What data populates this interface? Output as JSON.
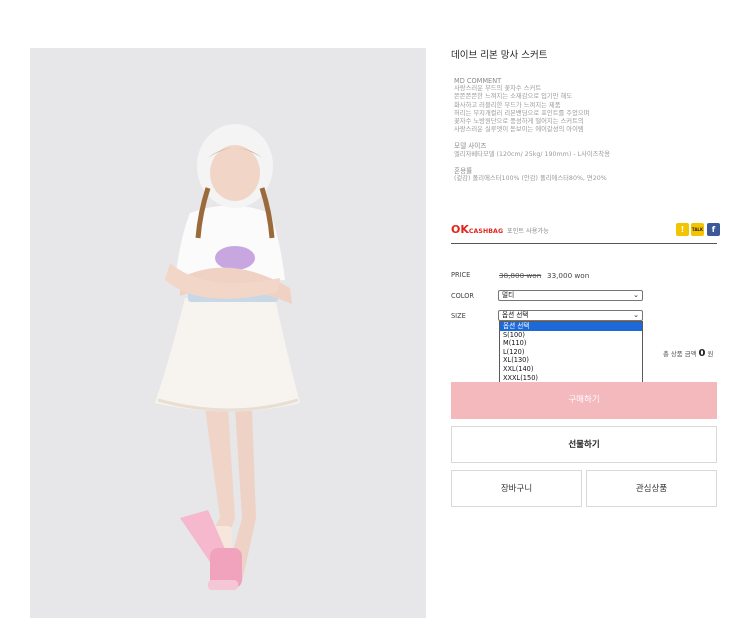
{
  "product": {
    "image_alt": "child model wearing white tulle skirt",
    "title": "데이브 리본 망사 스커트",
    "description": {
      "md_heading": "MD COMMENT",
      "md_lines": [
        "사랑스러운 무드의 꽃자수 스커트",
        "쫀쫀쫀쫀한 느껴지는 소재감으로 입기만 해도",
        "화사하고 러블리한 무드가 느껴지는 제품",
        "허리는 무지개컬러 리본밴딩으로 포인트를 주었으며",
        "꽃자수 노방원단으로 풍성하게 떨어지는 스커트의",
        "사랑스러운 실루엣이 돋보이는 에이갈성의 아이템"
      ],
      "model_heading": "모델 사이즈",
      "model_text": "엘리자베타모델 (120cm/ 25kg/ 190mm) - L사이즈착용",
      "material_heading": "혼용률",
      "material_text": "(겉감) 폴리에스터100% (안감) 폴리에스터80%, 면20%"
    }
  },
  "okcashbag": {
    "logo_ok": "OK",
    "logo_cashbag": "CASHBAG",
    "text": "포인트 사용가능"
  },
  "share": {
    "kakaostory_icon": "kakaostory-icon",
    "kakaotalk_icon": "kakaotalk-icon",
    "facebook_icon": "facebook-icon",
    "facebook_glyph": "f",
    "talk_glyph": "TALK",
    "story_glyph": "!"
  },
  "price": {
    "label": "PRICE",
    "original": "38,800 won",
    "sale": "33,000 won"
  },
  "color": {
    "label": "COLOR",
    "selected": "멀티"
  },
  "size": {
    "label": "SIZE",
    "selected": "옵션 선택",
    "options": [
      "옵션 선택",
      "S(100)",
      "M(110)",
      "L(120)",
      "XL(130)",
      "XXL(140)",
      "XXXL(150)"
    ]
  },
  "total": {
    "label": "총 상품 금액",
    "amount": "0",
    "unit": "원"
  },
  "buttons": {
    "buy": "구매하기",
    "gift": "선물하기",
    "cart": "장바구니",
    "wishlist": "관심상품"
  },
  "colors": {
    "buy_button": "#f3b9bd",
    "price_strike": "#555555",
    "ok_red": "#e2231a",
    "dropdown_highlight": "#1e69d8"
  }
}
